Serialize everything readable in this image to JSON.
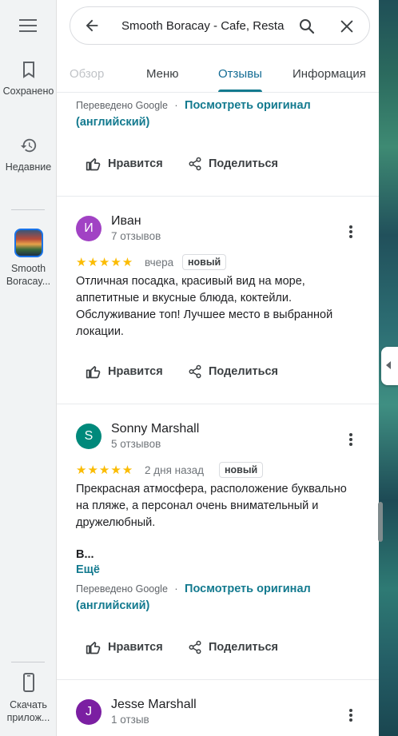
{
  "rail": {
    "items": [
      {
        "label": "Сохранено",
        "icon": "bookmark-icon"
      },
      {
        "label": "Недавние",
        "icon": "history-icon"
      },
      {
        "label": "Smooth Boracay...",
        "icon": "place-thumbnail"
      },
      {
        "label": "Скачать прилож...",
        "icon": "phone-icon"
      }
    ]
  },
  "search": {
    "value": "Smooth Boracay - Cafe, Resta"
  },
  "tabs": [
    {
      "label": "Обзор"
    },
    {
      "label": "Меню"
    },
    {
      "label": "Отзывы"
    },
    {
      "label": "Информация"
    }
  ],
  "top_fragment": {
    "translated": "Переведено Google",
    "dot": "·",
    "view_original": "Посмотреть оригинал",
    "lang": "(английский)",
    "like": "Нравится",
    "share": "Поделиться"
  },
  "reviews": [
    {
      "avatar_letter": "И",
      "avatar_color": "#a142c4",
      "name": "Иван",
      "count": "7 отзывов",
      "stars": "★★★★★",
      "when": "вчера",
      "badge": "новый",
      "text": "Отличная посадка, красивый вид на море, аппетитные и вкусные блюда, коктейли. Обслуживание топ! Лучшее место в выбранной локации.",
      "like": "Нравится",
      "share": "Поделиться"
    },
    {
      "avatar_letter": "S",
      "avatar_color": "#00897b",
      "name": "Sonny Marshall",
      "count": "5 отзывов",
      "stars": "★★★★★",
      "when": "2 дня назад",
      "badge": "новый",
      "text": "Прекрасная атмосфера, расположение буквально на пляже, а персонал очень внимательный и дружелюбный.",
      "bold": "В...",
      "more": "Ещё",
      "translated": "Переведено Google",
      "dot": "·",
      "view_original": "Посмотреть оригинал",
      "lang": "(английский)",
      "like": "Нравится",
      "share": "Поделиться"
    },
    {
      "avatar_letter": "J",
      "avatar_color": "#7b1fa2",
      "name": "Jesse Marshall",
      "count": "1 отзыв"
    }
  ],
  "colors": {
    "accent": "#137a8f",
    "star": "#fbbc04"
  }
}
